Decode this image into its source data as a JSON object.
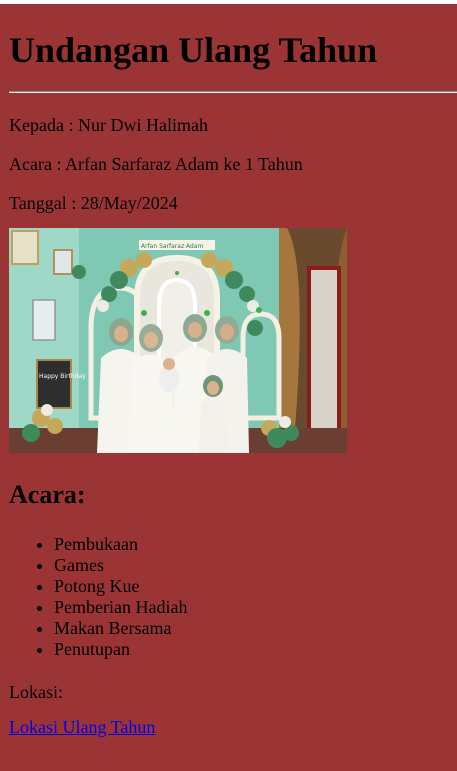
{
  "title": "Undangan Ulang Tahun",
  "details": {
    "to": "Kepada : Nur Dwi Halimah",
    "event": "Acara : Arfan Sarfaraz Adam ke 1 Tahun",
    "date": "Tanggal : 28/May/2024"
  },
  "photo": {
    "banner_text": "Arfan Sarfaraz Adam",
    "sign_text": "Happy Birthday"
  },
  "agenda": {
    "heading": "Acara:",
    "items": [
      "Pembukaan",
      "Games",
      "Potong Kue",
      "Pemberian Hadiah",
      "Makan Bersama",
      "Penutupan"
    ]
  },
  "location": {
    "label": "Lokasi:",
    "link_text": "Lokasi Ulang Tahun"
  },
  "colors": {
    "background": "#9b3535",
    "link": "#0000ee"
  }
}
